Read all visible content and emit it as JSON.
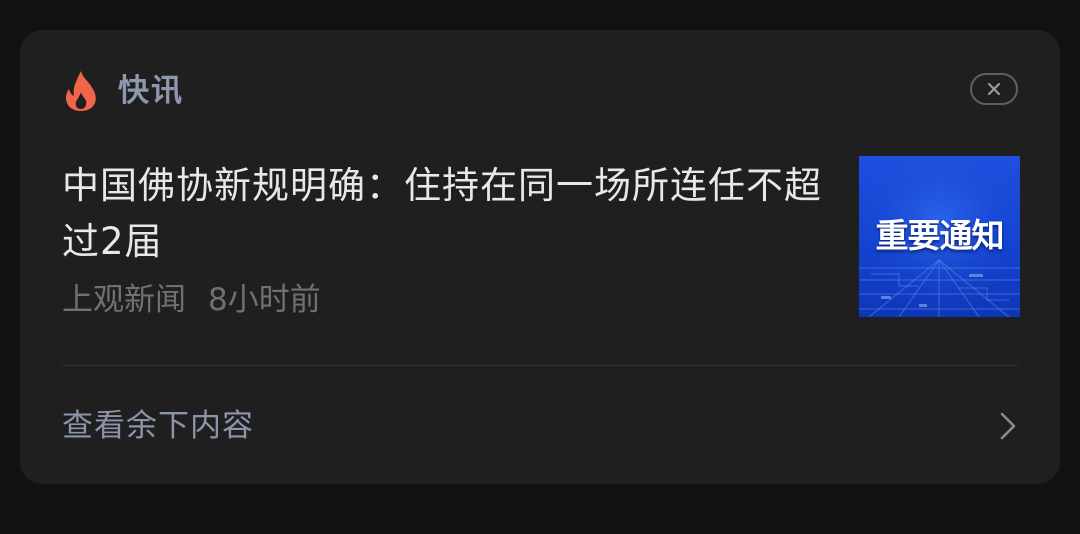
{
  "card": {
    "section_title": "快讯",
    "icons": {
      "section": "flame-icon",
      "close": "close-icon",
      "more": "chevron-right-icon"
    }
  },
  "article": {
    "headline": "中国佛协新规明确：住持在同一场所连任不超过2届",
    "source": "上观新闻",
    "time": "8小时前",
    "thumbnail_text": "重要通知"
  },
  "footer": {
    "label": "查看余下内容"
  },
  "colors": {
    "page_bg": "#111111",
    "card_bg": "#1f1f1f",
    "flame": "#f0654a",
    "section_title": "#8e97ad",
    "headline": "#e8e8e8",
    "meta": "#707070",
    "thumbnail_bg": "#1447d6"
  }
}
